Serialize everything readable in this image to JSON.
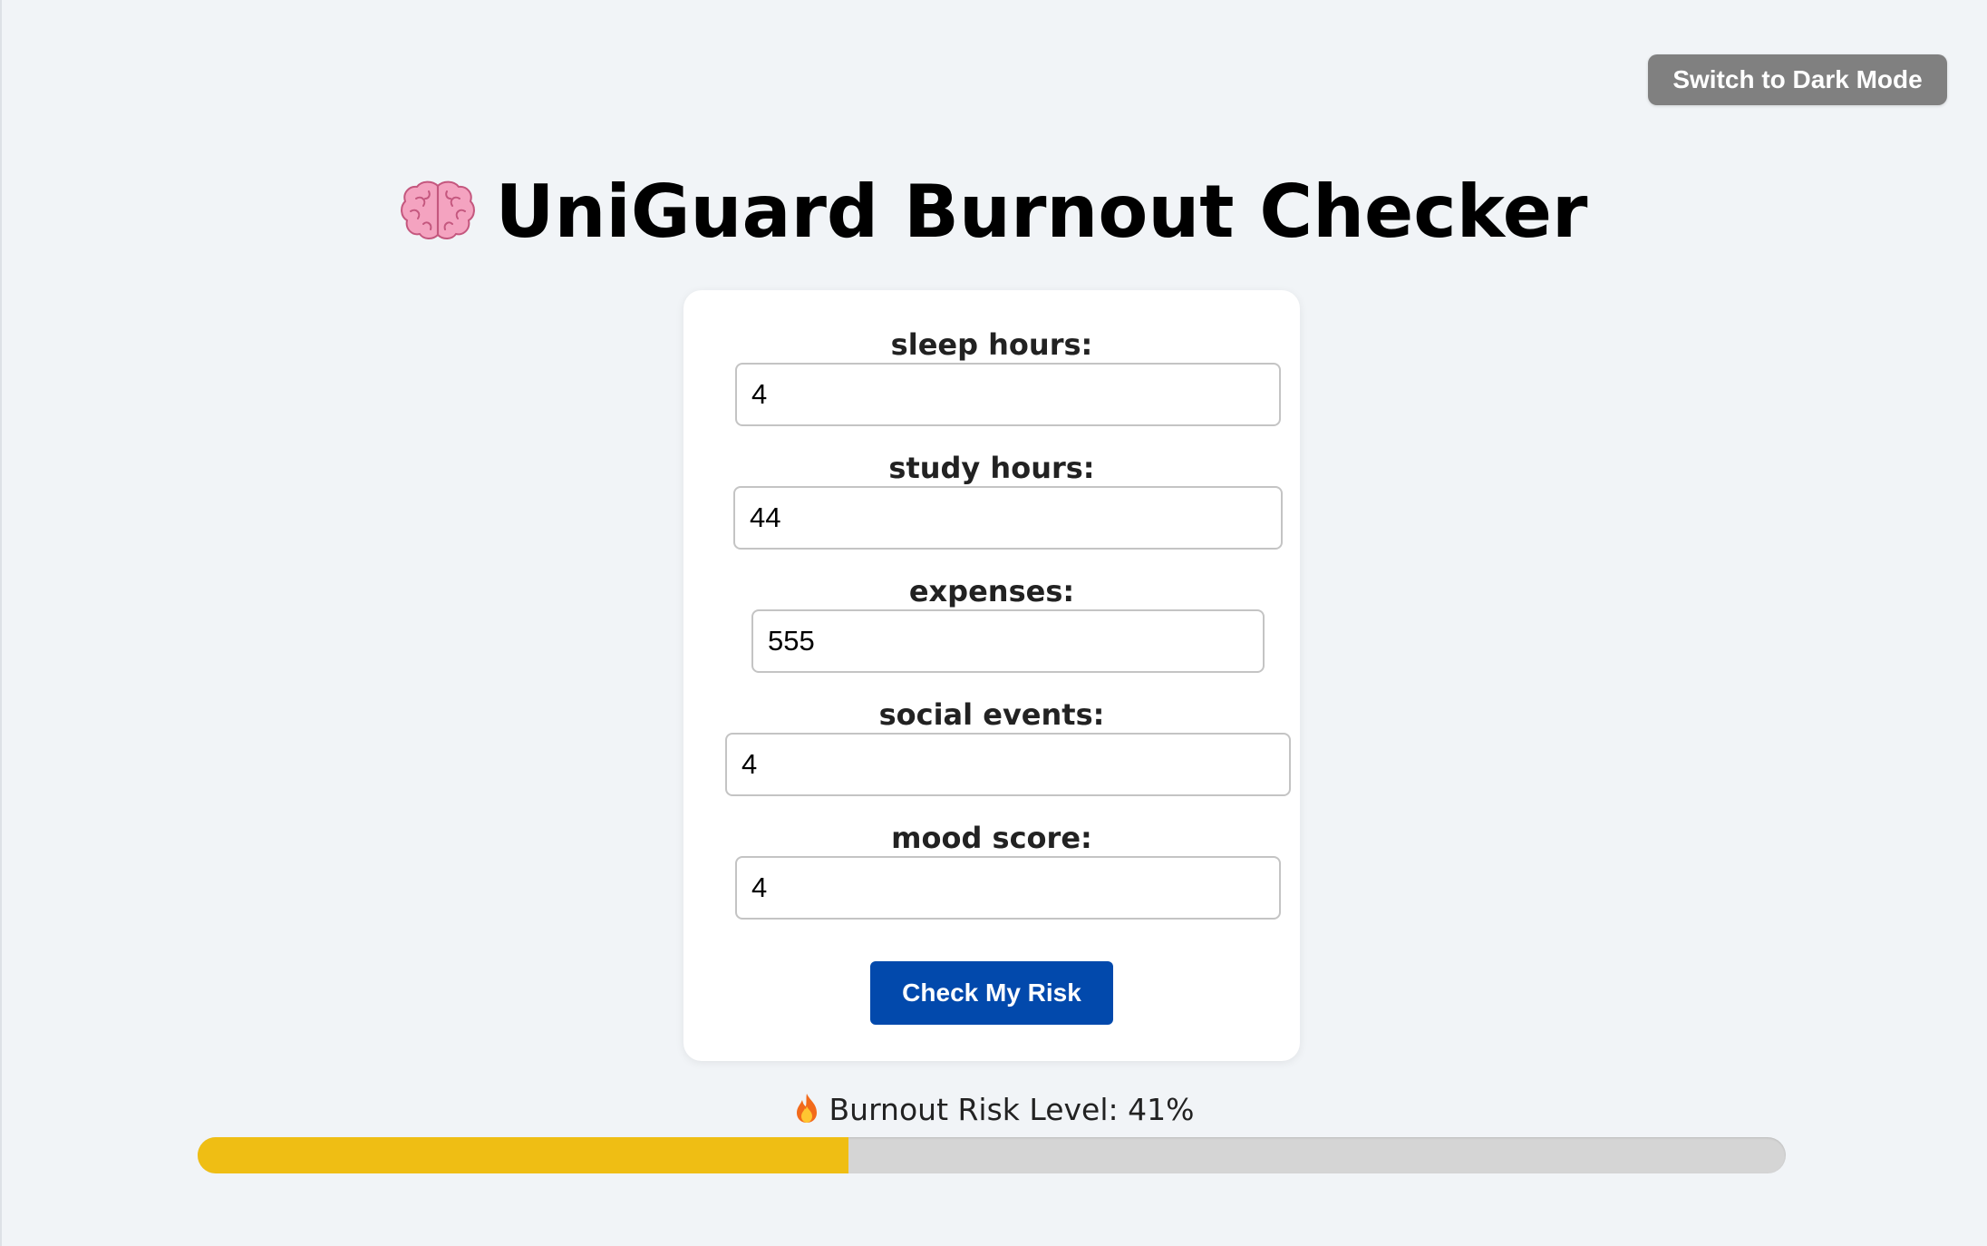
{
  "header": {
    "theme_toggle_label": "Switch to Dark Mode",
    "title": "UniGuard Burnout Checker",
    "title_icon": "brain-icon"
  },
  "form": {
    "fields": [
      {
        "label": "sleep hours:",
        "value": "4"
      },
      {
        "label": "study hours:",
        "value": "44"
      },
      {
        "label": "expenses:",
        "value": "555"
      },
      {
        "label": "social events:",
        "value": "4"
      },
      {
        "label": "mood score:",
        "value": "4"
      }
    ],
    "submit_label": "Check My Risk"
  },
  "result": {
    "icon": "fire-icon",
    "text": "Burnout Risk Level: 41%",
    "risk_percent": 41
  },
  "colors": {
    "background": "#f1f4f7",
    "accent_button": "#0249ac",
    "toggle_button": "#808080",
    "progress_fill": "#efbe14",
    "progress_track": "#d5d5d5"
  }
}
